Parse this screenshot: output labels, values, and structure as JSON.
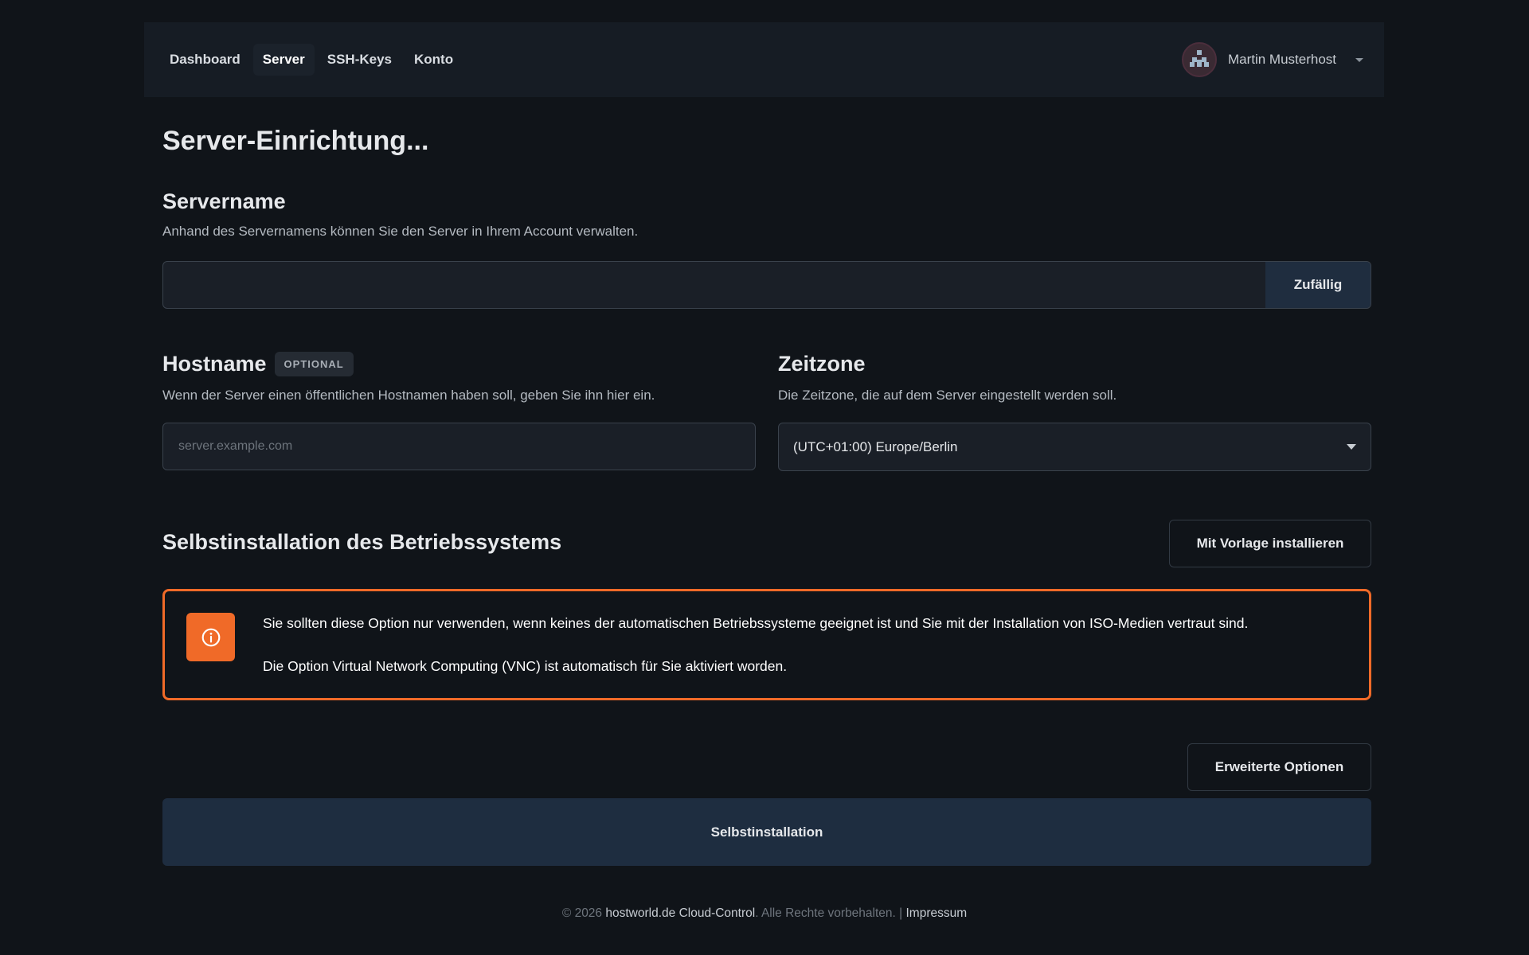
{
  "nav": {
    "links": [
      "Dashboard",
      "Server",
      "SSH-Keys",
      "Konto"
    ],
    "active": "Server",
    "user_name": "Martin Musterhost"
  },
  "page": {
    "title": "Server-Einrichtung..."
  },
  "servername": {
    "heading": "Servername",
    "description": "Anhand des Servernamens können Sie den Server in Ihrem Account verwalten.",
    "value": "",
    "random_button": "Zufällig"
  },
  "hostname": {
    "heading": "Hostname",
    "badge": "OPTIONAL",
    "description": "Wenn der Server einen öffentlichen Hostnamen haben soll, geben Sie ihn hier ein.",
    "placeholder": "server.example.com"
  },
  "timezone": {
    "heading": "Zeitzone",
    "description": "Die Zeitzone, die auf dem Server eingestellt werden soll.",
    "selected": "(UTC+01:00) Europe/Berlin"
  },
  "os": {
    "heading": "Selbstinstallation des Betriebssystems",
    "template_button": "Mit Vorlage installieren"
  },
  "alert": {
    "color": "#f06a28",
    "icon": "info-icon",
    "line1": "Sie sollten diese Option nur verwenden, wenn keines der automatischen Betriebssysteme geeignet ist und Sie mit der Installation von ISO-Medien vertraut sind.",
    "line2": "Die Option Virtual Network Computing (VNC) ist automatisch für Sie aktiviert worden."
  },
  "actions": {
    "advanced_button": "Erweiterte Optionen",
    "submit_button": "Selbstinstallation"
  },
  "footer": {
    "copyright": "© 2026",
    "brand": "hostworld.de Cloud-Control",
    "rights": ". Alle Rechte vorbehalten. |",
    "impressum": "Impressum"
  }
}
